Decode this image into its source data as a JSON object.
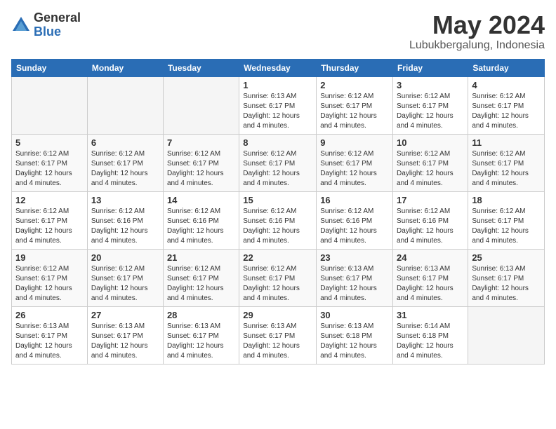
{
  "logo": {
    "general": "General",
    "blue": "Blue"
  },
  "title": "May 2024",
  "location": "Lubukbergalung, Indonesia",
  "days_of_week": [
    "Sunday",
    "Monday",
    "Tuesday",
    "Wednesday",
    "Thursday",
    "Friday",
    "Saturday"
  ],
  "weeks": [
    [
      {
        "day": "",
        "info": "",
        "empty": true
      },
      {
        "day": "",
        "info": "",
        "empty": true
      },
      {
        "day": "",
        "info": "",
        "empty": true
      },
      {
        "day": "1",
        "info": "Sunrise: 6:13 AM\nSunset: 6:17 PM\nDaylight: 12 hours\nand 4 minutes."
      },
      {
        "day": "2",
        "info": "Sunrise: 6:12 AM\nSunset: 6:17 PM\nDaylight: 12 hours\nand 4 minutes."
      },
      {
        "day": "3",
        "info": "Sunrise: 6:12 AM\nSunset: 6:17 PM\nDaylight: 12 hours\nand 4 minutes."
      },
      {
        "day": "4",
        "info": "Sunrise: 6:12 AM\nSunset: 6:17 PM\nDaylight: 12 hours\nand 4 minutes."
      }
    ],
    [
      {
        "day": "5",
        "info": "Sunrise: 6:12 AM\nSunset: 6:17 PM\nDaylight: 12 hours\nand 4 minutes."
      },
      {
        "day": "6",
        "info": "Sunrise: 6:12 AM\nSunset: 6:17 PM\nDaylight: 12 hours\nand 4 minutes."
      },
      {
        "day": "7",
        "info": "Sunrise: 6:12 AM\nSunset: 6:17 PM\nDaylight: 12 hours\nand 4 minutes."
      },
      {
        "day": "8",
        "info": "Sunrise: 6:12 AM\nSunset: 6:17 PM\nDaylight: 12 hours\nand 4 minutes."
      },
      {
        "day": "9",
        "info": "Sunrise: 6:12 AM\nSunset: 6:17 PM\nDaylight: 12 hours\nand 4 minutes."
      },
      {
        "day": "10",
        "info": "Sunrise: 6:12 AM\nSunset: 6:17 PM\nDaylight: 12 hours\nand 4 minutes."
      },
      {
        "day": "11",
        "info": "Sunrise: 6:12 AM\nSunset: 6:17 PM\nDaylight: 12 hours\nand 4 minutes."
      }
    ],
    [
      {
        "day": "12",
        "info": "Sunrise: 6:12 AM\nSunset: 6:17 PM\nDaylight: 12 hours\nand 4 minutes."
      },
      {
        "day": "13",
        "info": "Sunrise: 6:12 AM\nSunset: 6:16 PM\nDaylight: 12 hours\nand 4 minutes."
      },
      {
        "day": "14",
        "info": "Sunrise: 6:12 AM\nSunset: 6:16 PM\nDaylight: 12 hours\nand 4 minutes."
      },
      {
        "day": "15",
        "info": "Sunrise: 6:12 AM\nSunset: 6:16 PM\nDaylight: 12 hours\nand 4 minutes."
      },
      {
        "day": "16",
        "info": "Sunrise: 6:12 AM\nSunset: 6:16 PM\nDaylight: 12 hours\nand 4 minutes."
      },
      {
        "day": "17",
        "info": "Sunrise: 6:12 AM\nSunset: 6:16 PM\nDaylight: 12 hours\nand 4 minutes."
      },
      {
        "day": "18",
        "info": "Sunrise: 6:12 AM\nSunset: 6:17 PM\nDaylight: 12 hours\nand 4 minutes."
      }
    ],
    [
      {
        "day": "19",
        "info": "Sunrise: 6:12 AM\nSunset: 6:17 PM\nDaylight: 12 hours\nand 4 minutes."
      },
      {
        "day": "20",
        "info": "Sunrise: 6:12 AM\nSunset: 6:17 PM\nDaylight: 12 hours\nand 4 minutes."
      },
      {
        "day": "21",
        "info": "Sunrise: 6:12 AM\nSunset: 6:17 PM\nDaylight: 12 hours\nand 4 minutes."
      },
      {
        "day": "22",
        "info": "Sunrise: 6:12 AM\nSunset: 6:17 PM\nDaylight: 12 hours\nand 4 minutes."
      },
      {
        "day": "23",
        "info": "Sunrise: 6:13 AM\nSunset: 6:17 PM\nDaylight: 12 hours\nand 4 minutes."
      },
      {
        "day": "24",
        "info": "Sunrise: 6:13 AM\nSunset: 6:17 PM\nDaylight: 12 hours\nand 4 minutes."
      },
      {
        "day": "25",
        "info": "Sunrise: 6:13 AM\nSunset: 6:17 PM\nDaylight: 12 hours\nand 4 minutes."
      }
    ],
    [
      {
        "day": "26",
        "info": "Sunrise: 6:13 AM\nSunset: 6:17 PM\nDaylight: 12 hours\nand 4 minutes."
      },
      {
        "day": "27",
        "info": "Sunrise: 6:13 AM\nSunset: 6:17 PM\nDaylight: 12 hours\nand 4 minutes."
      },
      {
        "day": "28",
        "info": "Sunrise: 6:13 AM\nSunset: 6:17 PM\nDaylight: 12 hours\nand 4 minutes."
      },
      {
        "day": "29",
        "info": "Sunrise: 6:13 AM\nSunset: 6:17 PM\nDaylight: 12 hours\nand 4 minutes."
      },
      {
        "day": "30",
        "info": "Sunrise: 6:13 AM\nSunset: 6:18 PM\nDaylight: 12 hours\nand 4 minutes."
      },
      {
        "day": "31",
        "info": "Sunrise: 6:14 AM\nSunset: 6:18 PM\nDaylight: 12 hours\nand 4 minutes."
      },
      {
        "day": "",
        "info": "",
        "empty": true
      }
    ]
  ]
}
